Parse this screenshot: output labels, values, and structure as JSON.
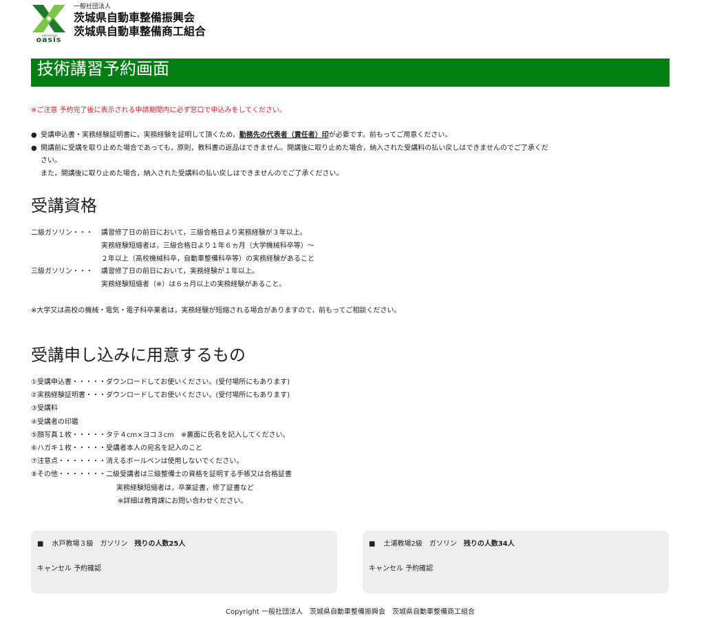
{
  "header": {
    "logo_caption": "welcome to",
    "logo_word": "oasis",
    "org_small": "一般社団法人",
    "org_line1": "茨城県自動車整備振興会",
    "org_line2": "茨城県自動車整備商工組合",
    "colors": {
      "green": "#037e12",
      "logo_lightgreen": "#7cc64a",
      "logo_darkgreen": "#1f7a2e"
    }
  },
  "page_title": "技術講習予約画面",
  "caution": "※ご注意 予約完了後に表示される申請期間内に必ず窓口で申込みをしてください。",
  "notes": {
    "bullet": "●",
    "n1_before": "受講申込書・実務経験証明書に，実務経験を証明して頂くため，",
    "n1_emph": "勤務先の代表者（責任者）印",
    "n1_after": "が必要です。前もってご用意ください。",
    "n2_line1": "開講前に受講を取り止めた場合であっても，原則，教科書の返品はできません。開講後に取り止めた場合，納入された受講料の払い戻しはできませんのでご了承くだ",
    "n2_line2": "さい。",
    "n2_line3": "また，開講後に取り止めた場合，納入された受講料の払い戻しはできませんのでご了承ください。"
  },
  "qualification": {
    "heading": "受講資格",
    "g2_key": "二級ガソリン・・・",
    "g2_l1": "講習修了日の前日において，三級合格日より実務経験が３年以上。",
    "g2_l2": "実務経験短縮者は，三級合格日より１年６ヵ月（大学機械科卒等）～",
    "g2_l3": "２年以上（高校機械科卒，自動車整備科卒等）の実務経験があること",
    "g3_key": "三級ガソリン・・・",
    "g3_l1": "講習修了日の前日において，実務経験が１年以上。",
    "g3_l2": "実務経験短縮者（※）は６ヵ月以上の実務経験があること。",
    "footnote": "※大学又は高校の機械・電気・電子科卒業者は，実務経験が短縮される場合がありますので，前もってご相談ください。"
  },
  "prepare": {
    "heading": "受講申し込みに用意するもの",
    "items": [
      "①受講申込書・・・・・ダウンロードしてお使いください。(受付場所にもあります)",
      "②実務経験証明書・・・ダウンロードしてお使いください。(受付場所にもあります)",
      "③受講料",
      "④受講者の印鑑",
      "⑤顔写真１枚・・・・・タテ４cm×ヨコ３cm　※裏面に氏名を記入してください。",
      "⑥ハガキ１枚・・・・・受講者本人の宛名を記入のこと",
      "⑦注意点・・・・・・・消えるボールペンは使用しないでください。",
      "⑧その他・・・・・・・二級受講者は三級整備士の資格を証明する手帳又は合格証書"
    ],
    "cont1": "実務経験短縮者は，卒業証書，修了証書など",
    "cont2": "※詳細は教育課にお問い合わせください。"
  },
  "cards": [
    {
      "square": "■",
      "title": "水戸教場３級　ガソリン",
      "remaining": "残りの人数25人",
      "cancel": "キャンセル",
      "confirm": "予約確認"
    },
    {
      "square": "■",
      "title": "土浦教場2級　ガソリン",
      "remaining": "残りの人数34人",
      "cancel": "キャンセル",
      "confirm": "予約確認"
    }
  ],
  "footer": "Copyright 一般社団法人　茨城県自動車整備振興会　茨城県自動車整備商工組合"
}
